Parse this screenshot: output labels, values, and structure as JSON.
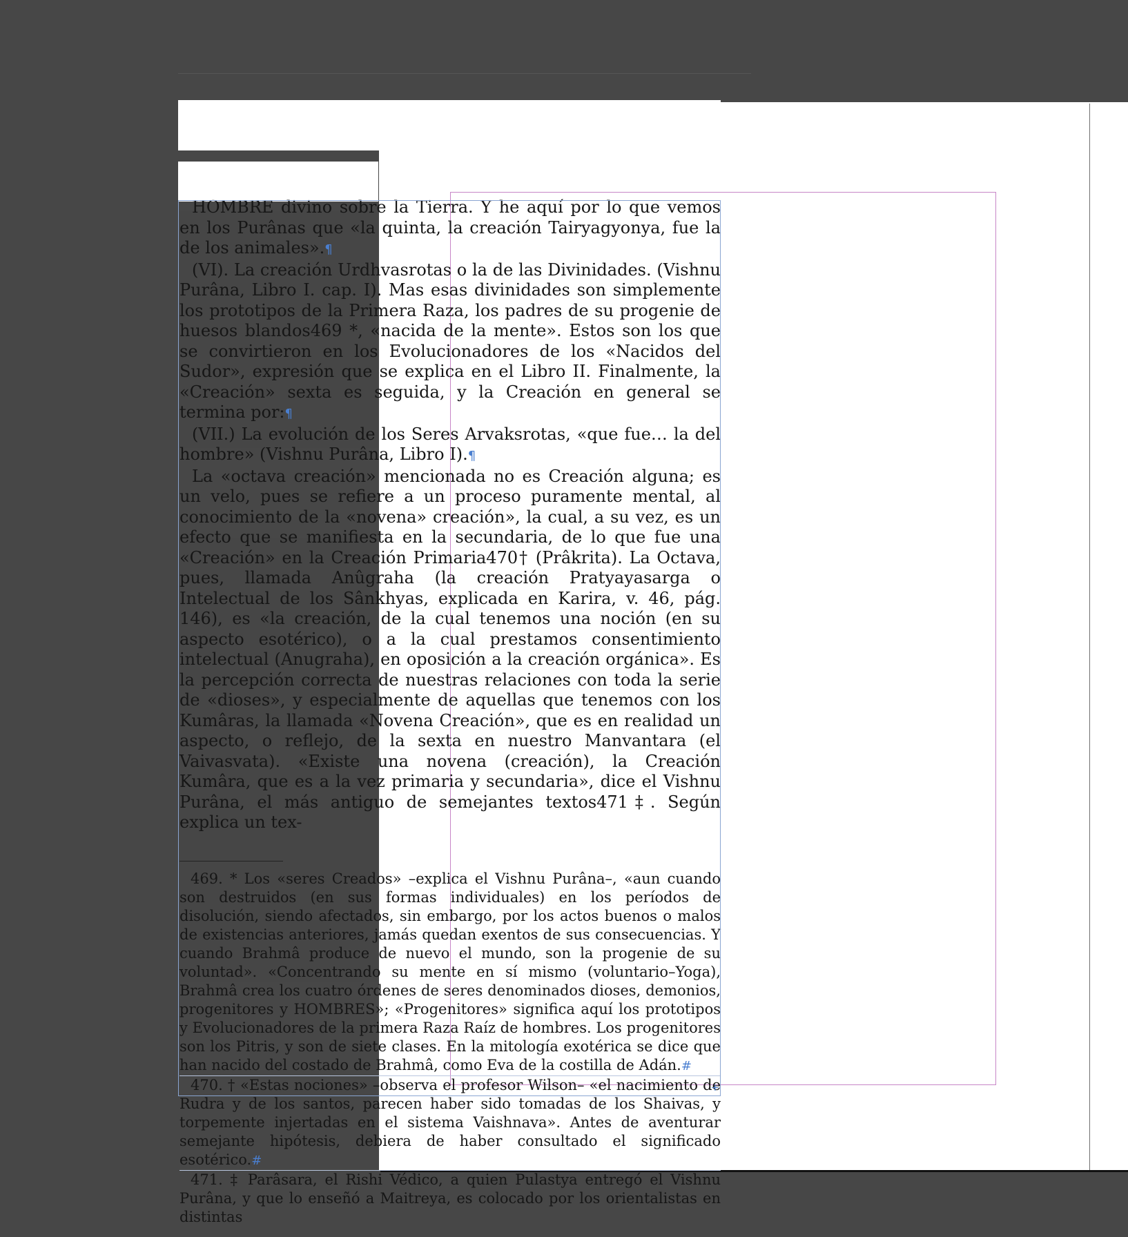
{
  "document": {
    "paragraphs": [
      "HOMBRE divino sobre la Tierra. Y he aquí por lo que vemos en los Purânas que «la quinta, la creación Tairyagyonya, fue la de los animales».",
      "(VI). La creación Urdhvasrotas o la de las Divinidades. (Vishnu Purâna, Libro I. cap. I). Mas esas divinidades son simplemente los prototipos de la Primera Raza, los padres de su progenie de huesos blandos469 *, «nacida de la mente». Estos son los que se convirtieron en los Evolucionadores de los «Nacidos del Sudor», expresión que se explica en el Libro II. Finalmente, la «Creación» sexta es seguida, y la Creación en general se termina por:",
      "(VII.) La evolución de los Seres Arvaksrotas, «que fue… la del hombre» (Vishnu Purâna, Libro I).",
      "La «octava creación» mencionada no es Creación alguna; es un velo, pues se refiere a un proceso puramente mental, al conocimiento de la «novena» creación», la cual, a su vez, es un efecto que se manifiesta en la secundaria, de lo que fue una «Creación» en la Creación Primaria470† (Prâkrita). La Octava, pues, llamada Anûgraha (la creación Pratyayasarga o Intelectual de los Sânkhyas, explicada en Karira, v. 46, pág. 146), es «la creación, de la cual tenemos una noción (en su aspecto esotérico), o a la cual prestamos consentimiento intelectual (Anugraha), en oposición a la creación orgánica». Es la percepción correcta de nuestras relaciones con toda la serie de «dioses», y especialmente de aquellas que tenemos con los Kumâras, la llamada «Novena Creación», que es en realidad un aspecto, o reflejo, de la sexta en nuestro Manvantara (el Vaivasvata). «Existe una novena (creación), la Creación Kumâra, que es a la vez primaria y secundaria», dice el Vishnu Purâna, el más antiguo de semejantes textos471‡. Según explica un tex-"
    ],
    "footnotes": [
      "469. * Los «seres Creados» –explica el Vishnu Purâna–, «aun cuando son destruidos (en sus formas individuales) en los períodos de disolución, siendo afectados, sin embargo, por los actos buenos o malos de existencias anteriores, jamás quedan exentos de sus consecuencias. Y cuando Brahmâ produce de nuevo el mundo, son la progenie de su voluntad». «Concentrando su mente en sí mismo (voluntario–Yoga), Brahmâ crea los cuatro órdenes de seres denominados dioses, demonios, progenitores y HOMBRES»; «Progenitores» significa aquí los prototipos y Evolucionadores de la primera Raza Raíz de hombres. Los progenitores son los Pitris, y son de siete clases. En la mitología exotérica se dice que han nacido del costado de Brahmâ, como Eva de la costilla de Adán.",
      "470. † «Estas nociones» –observa el profesor Wilson– «el nacimiento de Rudra y de los santos, parecen haber sido tomadas de los Shaivas, y torpemente injertadas en el sistema Vaishnava». Antes de aventurar semejante hipótesis, debiera de haber consultado el significado esotérico.",
      "471. ‡ Parâsara, el Rishi Védico, a quien Pulastya entregó el Vishnu Purâna, y que lo enseñó a Maitreya, es colocado por los orientalistas en distintas"
    ],
    "marks": {
      "pilcrow": "¶",
      "end_of_story": "#",
      "overset": "+"
    }
  },
  "colors": {
    "pasteboard": "#474747",
    "page": "#ffffff",
    "text_frame": "#8aa5d2",
    "margin_guide": "#c785c7",
    "hidden_char": "#4a7fd0"
  }
}
